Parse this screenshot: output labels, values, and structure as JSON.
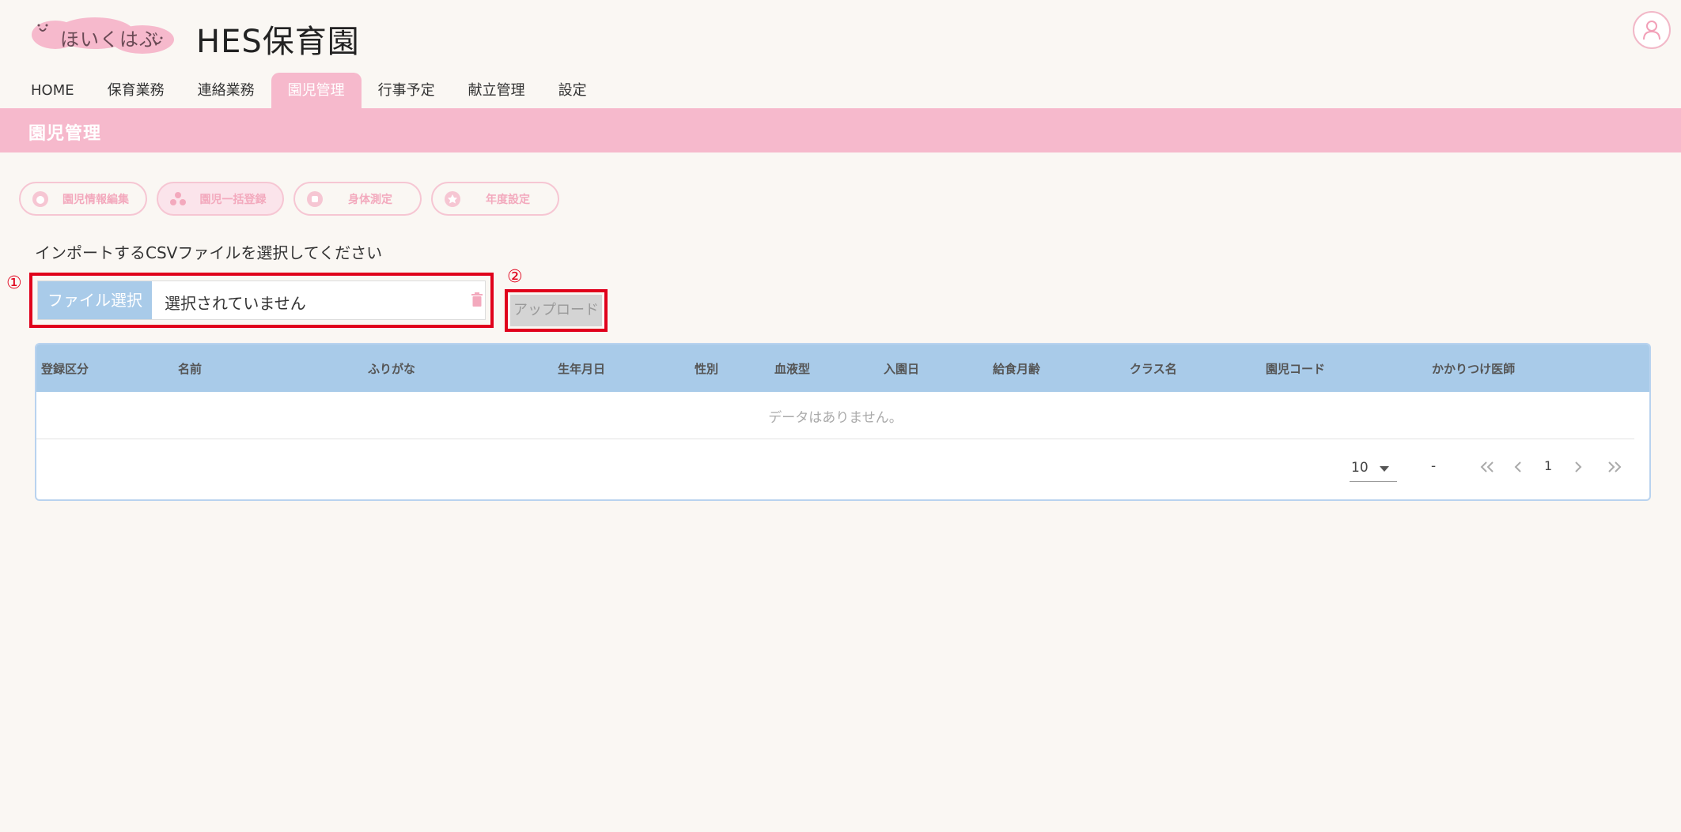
{
  "header": {
    "logo_text": "ほいくはぶ",
    "site_title": "HES保育園"
  },
  "nav": {
    "items": [
      {
        "label": "HOME"
      },
      {
        "label": "保育業務"
      },
      {
        "label": "連絡業務"
      },
      {
        "label": "園児管理"
      },
      {
        "label": "行事予定"
      },
      {
        "label": "献立管理"
      },
      {
        "label": "設定"
      }
    ]
  },
  "band": {
    "title": "園児管理"
  },
  "actions": {
    "edit_info": "園児情報編集",
    "bulk_register": "園児一括登録",
    "measurement": "身体測定",
    "year_setting": "年度設定"
  },
  "instruction": "インポートするCSVファイルを選択してください",
  "markers": {
    "one": "①",
    "two": "②"
  },
  "file_select": {
    "button_label": "ファイル選択",
    "file_name": "選択されていません"
  },
  "upload": {
    "label": "アップロード"
  },
  "table": {
    "headers": [
      "登録区分",
      "名前",
      "ふりがな",
      "生年月日",
      "性別",
      "血液型",
      "入園日",
      "給食月齢",
      "クラス名",
      "園児コード",
      "かかりつけ医師"
    ],
    "empty_text": "データはありません。"
  },
  "pager": {
    "per_page": "10",
    "range": "-",
    "page": "1"
  },
  "colors": {
    "accent_pink": "#f6b9cc",
    "table_header_blue": "#a9cbe9",
    "annotation_red": "#e0001b"
  }
}
